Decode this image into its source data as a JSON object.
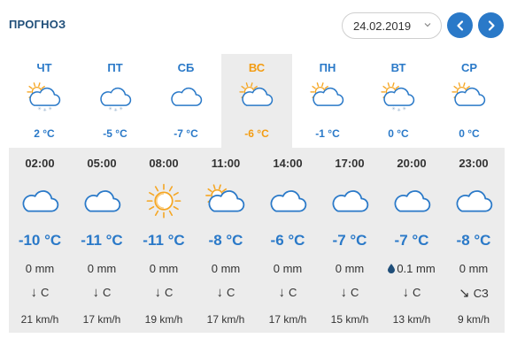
{
  "header": {
    "title": "ПРОГНОЗ",
    "date_value": "24.02.2019",
    "prev_icon": "chevron-left-icon",
    "next_icon": "chevron-right-icon",
    "accent": "#2a79c8"
  },
  "days": [
    {
      "name": "ЧТ",
      "temp": "2 °C",
      "icon": "partly-cloudy-snow",
      "active": false
    },
    {
      "name": "ПТ",
      "temp": "-5 °C",
      "icon": "cloudy-snow",
      "active": false
    },
    {
      "name": "СБ",
      "temp": "-7 °C",
      "icon": "cloud",
      "active": false
    },
    {
      "name": "ВС",
      "temp": "-6 °C",
      "icon": "partly-cloudy",
      "active": true
    },
    {
      "name": "ПН",
      "temp": "-1 °C",
      "icon": "partly-cloudy",
      "active": false
    },
    {
      "name": "ВТ",
      "temp": "0 °C",
      "icon": "partly-cloudy-snow",
      "active": false
    },
    {
      "name": "СР",
      "temp": "0 °C",
      "icon": "partly-cloudy",
      "active": false
    }
  ],
  "hours": [
    {
      "time": "02:00",
      "temp": "-10 °C",
      "precip": "0 mm",
      "rain": false,
      "wind_arrow": "↓",
      "wind_dir": "С",
      "speed": "21 km/h",
      "icon": "cloud"
    },
    {
      "time": "05:00",
      "temp": "-11 °C",
      "precip": "0 mm",
      "rain": false,
      "wind_arrow": "↓",
      "wind_dir": "С",
      "speed": "17 km/h",
      "icon": "cloud"
    },
    {
      "time": "08:00",
      "temp": "-11 °C",
      "precip": "0 mm",
      "rain": false,
      "wind_arrow": "↓",
      "wind_dir": "С",
      "speed": "19 km/h",
      "icon": "sun"
    },
    {
      "time": "11:00",
      "temp": "-8 °C",
      "precip": "0 mm",
      "rain": false,
      "wind_arrow": "↓",
      "wind_dir": "С",
      "speed": "17 km/h",
      "icon": "partly-cloudy"
    },
    {
      "time": "14:00",
      "temp": "-6 °C",
      "precip": "0 mm",
      "rain": false,
      "wind_arrow": "↓",
      "wind_dir": "С",
      "speed": "17 km/h",
      "icon": "cloud"
    },
    {
      "time": "17:00",
      "temp": "-7 °C",
      "precip": "0 mm",
      "rain": false,
      "wind_arrow": "↓",
      "wind_dir": "С",
      "speed": "15 km/h",
      "icon": "cloud"
    },
    {
      "time": "20:00",
      "temp": "-7 °C",
      "precip": "0.1 mm",
      "rain": true,
      "wind_arrow": "↓",
      "wind_dir": "С",
      "speed": "13 km/h",
      "icon": "cloud"
    },
    {
      "time": "23:00",
      "temp": "-8 °C",
      "precip": "0 mm",
      "rain": false,
      "wind_arrow": "↘",
      "wind_dir": "СЗ",
      "speed": "9 km/h",
      "icon": "cloud"
    }
  ]
}
